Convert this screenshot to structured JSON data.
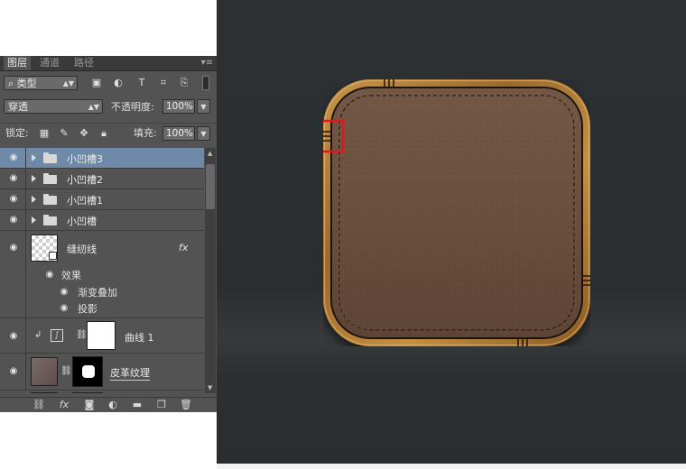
{
  "panel": {
    "tabs": [
      {
        "label": "图层"
      },
      {
        "label": "通道"
      },
      {
        "label": "路径"
      }
    ],
    "filter": {
      "icon": "search-icon",
      "label": "类型"
    },
    "blend_mode": "穿透",
    "opacity": {
      "label": "不透明度:",
      "value": "100%"
    },
    "lock": {
      "label": "锁定:"
    },
    "fill": {
      "label": "填充:",
      "value": "100%"
    },
    "layers": [
      {
        "name": "小凹槽3",
        "type": "group",
        "selected": true
      },
      {
        "name": "小凹槽2",
        "type": "group"
      },
      {
        "name": "小凹槽1",
        "type": "group"
      },
      {
        "name": "小凹槽",
        "type": "group"
      },
      {
        "name": "缝纫线",
        "type": "layer",
        "fx": "fx"
      },
      {
        "name": "曲线 1",
        "type": "adjustment"
      },
      {
        "name": "皮革纹理",
        "type": "layer"
      }
    ],
    "effects": {
      "label": "效果",
      "items": [
        "渐变叠加",
        "投影"
      ]
    }
  },
  "canvas": {
    "background_color": "#2d3033",
    "leather_color": "#6e5140",
    "wood_color": "#b7883e",
    "highlight_color": "#e8141c"
  }
}
